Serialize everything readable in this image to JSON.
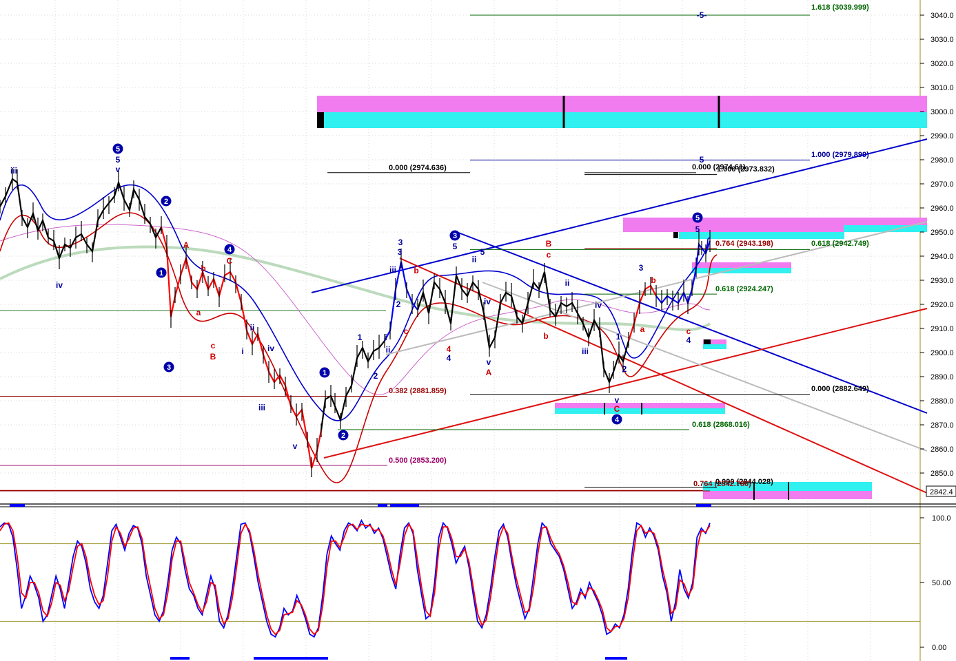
{
  "chart_data": [
    {
      "type": "line",
      "panel": "price",
      "y_axis": {
        "ticks": [
          2850,
          2860,
          2870,
          2880,
          2890,
          2900,
          2910,
          2920,
          2930,
          2940,
          2950,
          2960,
          2970,
          2980,
          2990,
          3000,
          3010,
          3020,
          3030,
          3040
        ],
        "tick_labels": [
          "2850.0",
          "2860.0",
          "2870.0",
          "2880.0",
          "2890.0",
          "2900.0",
          "2910.0",
          "2920.0",
          "2930.0",
          "2940.0",
          "2950.0",
          "2960.0",
          "2970.0",
          "2980.0",
          "2990.0",
          "3000.0",
          "3010.0",
          "3020.0",
          "3030.0",
          "3040.0"
        ],
        "range": [
          2840,
          3045
        ],
        "position": "right"
      },
      "last_price_label": "2842.4",
      "grid": true,
      "fib_levels": [
        {
          "text": "1.618 (3039.999)",
          "value": 3039.999,
          "color": "#006600"
        },
        {
          "text": "1.000 (2979.899)",
          "value": 2979.899,
          "color": "#000099"
        },
        {
          "text": "0.000 (2974.636)",
          "value": 2974.636,
          "color": "#000000"
        },
        {
          "text": "0.000 (2974.61)",
          "value": 2974.61,
          "color": "#000000"
        },
        {
          "text": "1.000 (2973.832)",
          "value": 2973.832,
          "color": "#000000"
        },
        {
          "text": "0.764 (2943.198)",
          "value": 2943.198,
          "color": "#990000"
        },
        {
          "text": "0.618 (2942.749)",
          "value": 2942.749,
          "color": "#006600"
        },
        {
          "text": "0.618 (2924.247)",
          "value": 2924.247,
          "color": "#006600"
        },
        {
          "text": "0.000 (2882.649)",
          "value": 2882.649,
          "color": "#000000"
        },
        {
          "text": "0.382 (2881.859)",
          "value": 2881.859,
          "color": "#990000"
        },
        {
          "text": "0.618 (2868.016)",
          "value": 2868.016,
          "color": "#006600"
        },
        {
          "text": "0.500 (2853.200)",
          "value": 2853.2,
          "color": "#990066"
        },
        {
          "text": "0.000 (2844.028)",
          "value": 2844.028,
          "color": "#000000"
        },
        {
          "text": "0.764 (2842.780)",
          "value": 2842.78,
          "color": "#990000"
        }
      ],
      "wave_labels": [
        "iii",
        "iv",
        "5",
        "v",
        "2",
        "1",
        "3",
        "A",
        "a",
        "b",
        "c",
        "B",
        "C",
        "4",
        "i",
        "ii",
        "iii",
        "iv",
        "v",
        "1",
        "2",
        "3",
        "4",
        "5",
        "iii",
        "i",
        "ii",
        "b",
        "c",
        "4",
        "2",
        "3",
        "5",
        "ii",
        "iv",
        "v",
        "A",
        "b",
        "B",
        "c",
        "ii",
        "iv",
        "iii",
        "v",
        "C",
        "4",
        "1",
        "2",
        "3",
        "a",
        "b",
        "c",
        "4",
        "5",
        "-5-",
        "5"
      ],
      "circled_labels": [
        "5",
        "2",
        "1",
        "3",
        "4",
        "1",
        "2",
        "3",
        "4",
        "5"
      ]
    },
    {
      "type": "line",
      "panel": "oscillator",
      "y_axis": {
        "ticks": [
          0,
          50,
          100
        ],
        "tick_labels": [
          "0.00",
          "50.00",
          "100.0"
        ],
        "range": [
          -3,
          105
        ],
        "position": "right"
      },
      "reference_lines": [
        20,
        80
      ],
      "series": [
        {
          "name": "",
          "color": "#0000ff",
          "values": [
            93,
            96,
            95,
            85,
            60,
            30,
            40,
            55,
            48,
            38,
            20,
            25,
            40,
            55,
            45,
            30,
            50,
            70,
            82,
            78,
            65,
            45,
            35,
            30,
            40,
            65,
            90,
            95,
            85,
            75,
            88,
            94,
            92,
            80,
            55,
            40,
            25,
            20,
            28,
            50,
            75,
            85,
            80,
            60,
            45,
            40,
            30,
            25,
            40,
            55,
            45,
            20,
            15,
            25,
            45,
            70,
            95,
            96,
            88,
            70,
            50,
            35,
            20,
            10,
            8,
            15,
            30,
            25,
            28,
            40,
            32,
            22,
            10,
            8,
            15,
            40,
            72,
            86,
            80,
            75,
            90,
            96,
            94,
            90,
            98,
            92,
            95,
            88,
            92,
            84,
            70,
            55,
            45,
            72,
            92,
            96,
            88,
            60,
            40,
            22,
            25,
            50,
            85,
            96,
            92,
            80,
            65,
            72,
            78,
            62,
            40,
            20,
            15,
            25,
            45,
            70,
            90,
            95,
            85,
            65,
            48,
            35,
            22,
            30,
            55,
            80,
            96,
            92,
            80,
            75,
            70,
            60,
            45,
            30,
            35,
            45,
            38,
            50,
            42,
            35,
            25,
            10,
            12,
            18,
            15,
            25,
            45,
            75,
            96,
            94,
            85,
            92,
            86,
            75,
            55,
            42,
            20,
            35,
            60,
            45,
            38,
            50,
            85,
            92,
            88,
            96
          ]
        },
        {
          "name": "",
          "color": "#ff0000",
          "values": [
            90,
            95,
            96,
            90,
            70,
            42,
            38,
            50,
            50,
            42,
            28,
            24,
            34,
            50,
            48,
            36,
            44,
            62,
            78,
            80,
            70,
            52,
            40,
            33,
            36,
            55,
            82,
            93,
            88,
            78,
            84,
            92,
            93,
            84,
            62,
            46,
            30,
            22,
            25,
            42,
            68,
            82,
            82,
            66,
            50,
            42,
            33,
            27,
            35,
            50,
            48,
            28,
            18,
            22,
            38,
            62,
            88,
            95,
            90,
            75,
            56,
            40,
            25,
            14,
            10,
            13,
            25,
            26,
            27,
            36,
            33,
            25,
            14,
            10,
            13,
            32,
            62,
            82,
            82,
            77,
            85,
            94,
            95,
            91,
            95,
            94,
            94,
            90,
            91,
            86,
            75,
            60,
            48,
            65,
            86,
            95,
            90,
            68,
            46,
            28,
            24,
            42,
            76,
            93,
            93,
            84,
            70,
            70,
            76,
            66,
            46,
            26,
            17,
            21,
            38,
            62,
            84,
            93,
            88,
            70,
            53,
            40,
            27,
            28,
            46,
            72,
            92,
            93,
            84,
            77,
            72,
            63,
            50,
            35,
            33,
            42,
            40,
            46,
            44,
            37,
            29,
            15,
            12,
            16,
            16,
            22,
            38,
            66,
            90,
            94,
            88,
            90,
            88,
            78,
            60,
            46,
            26,
            30,
            52,
            49,
            40,
            46,
            76,
            90,
            89,
            94
          ]
        }
      ]
    }
  ],
  "colors": {
    "price_bar": "#000000",
    "up_wave": "#0000ff",
    "down_wave": "#ff0000",
    "ma_blue": "#0000cc",
    "ma_red": "#cc0000",
    "ma_green": "#b5d6b5",
    "ma_purple": "#cc66cc",
    "zone_pink": "#f07cf0",
    "zone_cyan": "#30f0f0",
    "axis_border": "#c0b060"
  }
}
